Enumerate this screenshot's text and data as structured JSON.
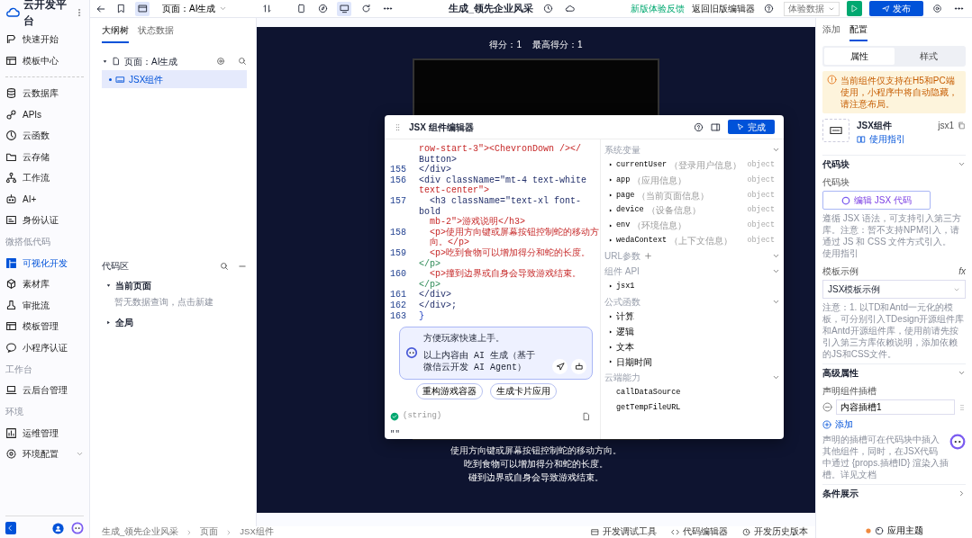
{
  "sidebar": {
    "logo": "云开发平台",
    "groups": [
      {
        "items": [
          {
            "label": "快速开始",
            "selected": false
          },
          {
            "label": "模板中心",
            "selected": false
          }
        ]
      },
      {
        "items": [
          {
            "label": "云数据库",
            "selected": false
          },
          {
            "label": "APIs",
            "selected": false
          },
          {
            "label": "云函数",
            "selected": false
          },
          {
            "label": "云存储",
            "selected": false
          },
          {
            "label": "工作流",
            "selected": false
          },
          {
            "label": "AI+",
            "selected": false
          },
          {
            "label": "身份认证",
            "selected": false
          }
        ]
      },
      {
        "title": "微搭低代码",
        "items": [
          {
            "label": "可视化开发",
            "selected": true
          },
          {
            "label": "素材库",
            "selected": false
          },
          {
            "label": "审批流",
            "selected": false
          },
          {
            "label": "模板管理",
            "selected": false
          },
          {
            "label": "小程序认证",
            "selected": false
          }
        ]
      },
      {
        "title": "工作台",
        "items": [
          {
            "label": "云后台管理",
            "selected": false
          }
        ]
      },
      {
        "title": "环境",
        "items": [
          {
            "label": "运维管理",
            "selected": false
          },
          {
            "label": "环境配置",
            "selected": false,
            "expanded": false
          }
        ]
      }
    ]
  },
  "toolbar": {
    "page_select": "页面：AI生成",
    "title": "生成_领先企业风采",
    "feedback": "新版体验反馈",
    "old_editor": "返回旧版编辑器",
    "data_select": "体验数据",
    "publish": "发布"
  },
  "outline": {
    "tabs": [
      {
        "label": "大纲树",
        "selected": true
      },
      {
        "label": "状态数据",
        "selected": false
      }
    ],
    "tree": [
      {
        "label": "页面：AI生成",
        "expanded": true,
        "selected": false,
        "children": [
          {
            "label": "JSX组件",
            "selected": true
          }
        ]
      }
    ]
  },
  "code_area": {
    "title": "代码区",
    "sections": [
      {
        "label": "当前页面",
        "expanded": true,
        "hint": "暂无数据查询，",
        "link": "点击新建"
      },
      {
        "label": "全局",
        "expanded": false
      }
    ]
  },
  "canvas": {
    "score": "得分：1",
    "best": "最高得分：1",
    "instructions": [
      "使用方向键或屏幕按钮控制蛇的移动方向。",
      "吃到食物可以增加得分和蛇的长度。",
      "碰到边界或自身会导致游戏结束。"
    ]
  },
  "editor": {
    "title": "JSX 组件编辑器",
    "done": "完成",
    "lines": [
      {
        "segments": [
          {
            "kind": "text",
            "text": "row-start-3\"><ChevronDown /></"
          }
        ]
      },
      {
        "segments": [
          {
            "kind": "plain",
            "text": "Button>"
          }
        ]
      },
      {
        "number": "155",
        "segments": [
          {
            "kind": "plain",
            "text": "</div>"
          }
        ]
      },
      {
        "number": "156",
        "segments": [
          {
            "kind": "plain",
            "text": "<div className=\"mt-4 text-white"
          }
        ]
      },
      {
        "segments": [
          {
            "kind": "text",
            "text": "text-center\">"
          }
        ]
      },
      {
        "number": "157",
        "segments": [
          {
            "kind": "plain",
            "text": "  <h3 className=\"text-xl font-bold"
          }
        ]
      },
      {
        "segments": [
          {
            "kind": "text",
            "text": "  mb-2\">游戏说明</h3>"
          }
        ]
      },
      {
        "number": "158",
        "segments": [
          {
            "kind": "text",
            "text": "  <p>使用方向键或屏幕按钮控制蛇的移动方"
          }
        ]
      },
      {
        "segments": [
          {
            "kind": "text",
            "text": "  向。</p>"
          }
        ]
      },
      {
        "number": "159",
        "segments": [
          {
            "kind": "text",
            "text": "  <p>吃到食物可以增加得分和蛇的长度。"
          },
          {
            "kind": "tag",
            "text": "</p>"
          }
        ]
      },
      {
        "number": "160",
        "segments": [
          {
            "kind": "text",
            "text": "  <p>撞到边界或自身会导致游戏结束。"
          },
          {
            "kind": "tag",
            "text": "</p>"
          }
        ]
      },
      {
        "number": "161",
        "segments": [
          {
            "kind": "plain",
            "text": "</div>"
          }
        ]
      },
      {
        "number": "162",
        "segments": [
          {
            "kind": "plain",
            "text": "</div>;"
          }
        ]
      },
      {
        "number": "163",
        "segments": [
          {
            "kind": "brace",
            "text": "}"
          }
        ]
      }
    ],
    "chat": {
      "text": "方便玩家快速上手。",
      "note": "以上内容由 AI 生成（基于微信云开发 AI Agent）",
      "chips": [
        "重构游戏容器",
        "生成卡片应用"
      ]
    },
    "result": {
      "type": "(string)",
      "value": "\"\""
    },
    "variables": [
      {
        "title": "系统变量",
        "items": [
          {
            "kind": "object",
            "name": "currentUser",
            "desc": "（登录用户信息）",
            "type": "object"
          },
          {
            "kind": "object",
            "name": "app",
            "desc": "（应用信息）",
            "type": "object"
          },
          {
            "kind": "object",
            "name": "page",
            "desc": "（当前页面信息）",
            "type": "object"
          },
          {
            "kind": "object",
            "name": "device",
            "desc": "（设备信息）",
            "type": "object"
          },
          {
            "kind": "object",
            "name": "env",
            "desc": "（环境信息）",
            "type": "object"
          },
          {
            "kind": "object",
            "name": "wedaContext",
            "desc": "（上下文信息）",
            "type": "object"
          }
        ]
      },
      {
        "title": "URL参数",
        "add": true
      },
      {
        "title": "组件 API",
        "items": [
          {
            "kind": "object",
            "name": "jsx1"
          }
        ]
      },
      {
        "title": "公式函数",
        "items": [
          {
            "kind": "group",
            "name": "计算"
          },
          {
            "kind": "group",
            "name": "逻辑"
          },
          {
            "kind": "group",
            "name": "文本"
          },
          {
            "kind": "group",
            "name": "日期时间"
          }
        ]
      },
      {
        "title": "云端能力",
        "items": [
          {
            "kind": "method",
            "name": "callDataSource"
          },
          {
            "kind": "method",
            "name": "getTempFileURL"
          }
        ]
      }
    ]
  },
  "right_panel": {
    "tabs": [
      {
        "label": "添加",
        "selected": false
      },
      {
        "label": "配置",
        "selected": true
      }
    ],
    "segments": [
      {
        "label": "属性",
        "selected": true
      },
      {
        "label": "样式",
        "selected": false
      }
    ],
    "warning": "当前组件仅支持在H5和PC端使用，小程序中将自动隐藏，请注意布局。",
    "component": {
      "name": "JSX组件",
      "guide": "使用指引",
      "id": "jsx1"
    },
    "code_block": {
      "title": "代码块",
      "expanded": true,
      "label": "代码块",
      "button": "编辑 JSX 代码",
      "note": [
        {
          "text": "遵循 JSX 语法，可支持引入第三方库。注意：暂不支持NPM引入，请通过 JS 和 CSS 文件方式引入。",
          "link": false
        },
        {
          "text": "使用指引",
          "link": true
        }
      ],
      "template_label": "模板示例",
      "formula": "fx",
      "template_value": "JSX模板示例",
      "template_note": [
        {
          "text": "注意：1. 以TD和Antd一元化的模板，可分别引入",
          "link": false
        },
        {
          "text": "TDesign开源组件库",
          "link": true
        },
        {
          "text": "和",
          "link": false
        },
        {
          "text": "Antd开源组件库",
          "link": true
        },
        {
          "text": "，使用前请先按",
          "link": false
        },
        {
          "text": "引入第三方库依赖说明",
          "link": true
        },
        {
          "text": "，添加依赖的JS和CSS文件。",
          "link": false
        }
      ]
    },
    "advanced": {
      "title": "高级属性",
      "expanded": true,
      "label": "声明组件插槽",
      "slots": [
        "内容插槽1"
      ],
      "add": "添加",
      "note": [
        {
          "text": "声明的插槽可在代码块中插入其他组件，同时，在JSX代码中通过 {props.插槽ID} 渲染入插槽。",
          "link": false
        },
        {
          "text": "详见文档",
          "link": true
        }
      ]
    },
    "condition": {
      "title": "条件展示",
      "expanded": false
    },
    "theme": "应用主题"
  },
  "status_bar": {
    "breadcrumb": [
      "生成_领先企业风采",
      "页面",
      "JSX组件"
    ],
    "tools": [
      "开发调试工具",
      "代码编辑器",
      "开发历史版本"
    ]
  }
}
